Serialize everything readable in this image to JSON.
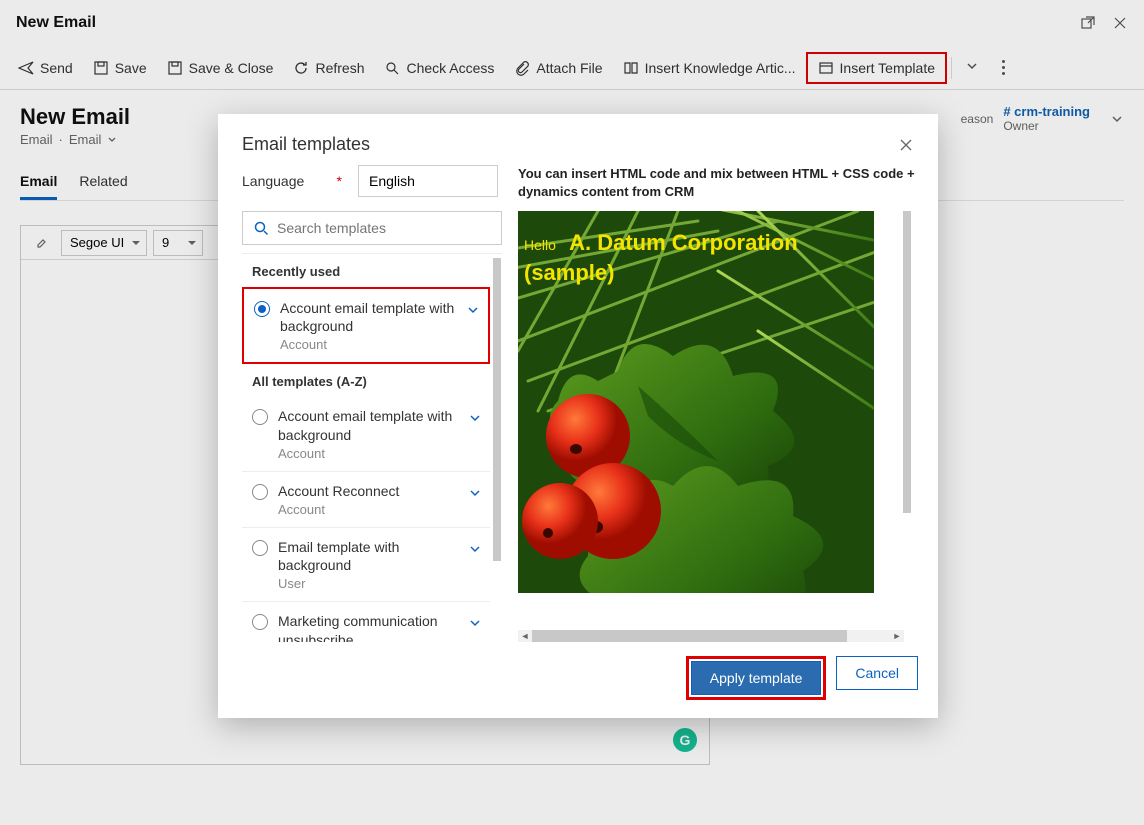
{
  "header": {
    "title": "New Email"
  },
  "toolbar": {
    "send": "Send",
    "save": "Save",
    "save_close": "Save & Close",
    "refresh": "Refresh",
    "check_access": "Check Access",
    "attach_file": "Attach File",
    "insert_knowledge": "Insert Knowledge Artic...",
    "insert_template": "Insert Template"
  },
  "page": {
    "title": "New Email",
    "breadcrumb_a": "Email",
    "breadcrumb_b": "Email",
    "owner_link": "# crm-training",
    "owner_label": "Owner",
    "tabs": {
      "email": "Email",
      "related": "Related"
    },
    "editor": {
      "font": "Segoe UI",
      "size": "9"
    }
  },
  "modal": {
    "title": "Email templates",
    "language_label": "Language",
    "language_value": "English",
    "search_placeholder": "Search templates",
    "section_recent": "Recently used",
    "section_all": "All templates (A-Z)",
    "templates_recent": [
      {
        "name": "Account email template with background",
        "type": "Account",
        "selected": true
      }
    ],
    "templates_all": [
      {
        "name": "Account email template with background",
        "type": "Account"
      },
      {
        "name": "Account Reconnect",
        "type": "Account"
      },
      {
        "name": "Email template with background",
        "type": "User"
      },
      {
        "name": "Marketing communication unsubscribe acknowledgement",
        "type": ""
      }
    ],
    "preview_caption": "You can insert HTML code and mix between HTML + CSS code + dynamics content from CRM",
    "preview_hello": "Hello",
    "preview_company_l1": "A. Datum Corporation",
    "preview_company_l2": "(sample)",
    "apply": "Apply template",
    "cancel": "Cancel"
  },
  "reason_label_partial": "eason"
}
